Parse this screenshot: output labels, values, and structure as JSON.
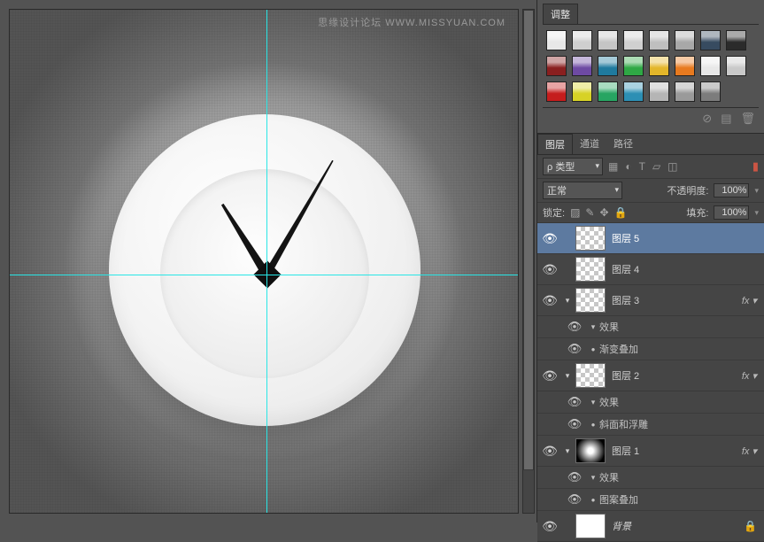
{
  "watermark": "思缘设计论坛  WWW.MISSYUAN.COM",
  "adjustments": {
    "tab_label": "调整",
    "swatches_row1": [
      "#e8e8e8",
      "#cfcfcf",
      "#c5c5c5",
      "#d0d0d0",
      "#bfbfbf",
      "#a8a8a8",
      "#374b60",
      "#2b2b2b"
    ],
    "swatches_row2": [
      "#8a1f1f",
      "#6e4aa3",
      "#1f7a9e",
      "#2fa845",
      "#e3b62a",
      "#e87a1f",
      "#e8e8e8",
      "#c9c9c9"
    ],
    "swatches_row3": [
      "#c51d1d",
      "#d7d226",
      "#27a562",
      "#2c8fb4",
      "#b5b5b5",
      "#9a9a9a",
      "#7c7c7c"
    ]
  },
  "layers_panel": {
    "tabs": {
      "layers": "图层",
      "channels": "通道",
      "paths": "路径"
    },
    "kind_prefix": "ρ",
    "kind_label": "类型",
    "blend_mode": "正常",
    "opacity_label": "不透明度:",
    "opacity_value": "100%",
    "lock_label": "锁定:",
    "fill_label": "填充:",
    "fill_value": "100%"
  },
  "layers": [
    {
      "name": "图层 5",
      "thumb": "checker",
      "fx": false,
      "active": true
    },
    {
      "name": "图层 4",
      "thumb": "checker",
      "fx": false
    },
    {
      "name": "图层 3",
      "thumb": "checker",
      "fx": true,
      "children": [
        {
          "txt": "效果",
          "type": "head"
        },
        {
          "txt": "渐变叠加",
          "type": "item"
        }
      ]
    },
    {
      "name": "图层 2",
      "thumb": "checker",
      "fx": true,
      "children": [
        {
          "txt": "效果",
          "type": "head"
        },
        {
          "txt": "斜面和浮雕",
          "type": "item"
        }
      ]
    },
    {
      "name": "图层 1",
      "thumb": "radial",
      "fx": true,
      "children": [
        {
          "txt": "效果",
          "type": "head"
        },
        {
          "txt": "图案叠加",
          "type": "item"
        }
      ]
    },
    {
      "name": "背景",
      "thumb": "white",
      "fx": false,
      "locked": true,
      "italic": true
    }
  ]
}
